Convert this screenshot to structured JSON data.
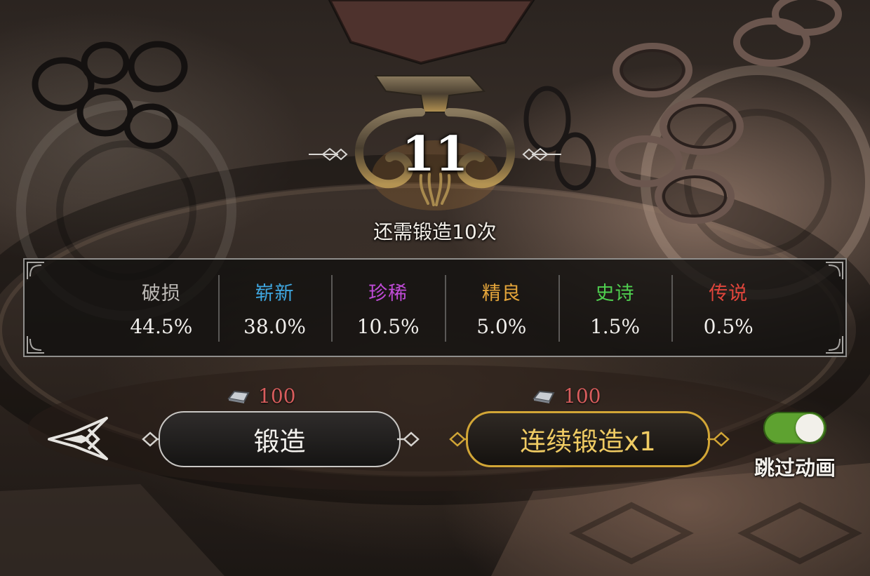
{
  "forge": {
    "count": "11",
    "remaining_text": "还需锻造10次"
  },
  "probabilities": [
    {
      "name": "破损",
      "value": "44.5%",
      "color": "#bdbab6"
    },
    {
      "name": "崭新",
      "value": "38.0%",
      "color": "#3fa7e0"
    },
    {
      "name": "珍稀",
      "value": "10.5%",
      "color": "#c04bd8"
    },
    {
      "name": "精良",
      "value": "5.0%",
      "color": "#e3a43a"
    },
    {
      "name": "史诗",
      "value": "1.5%",
      "color": "#4fce4f"
    },
    {
      "name": "传说",
      "value": "0.5%",
      "color": "#e0453b"
    }
  ],
  "costs": {
    "forge": "100",
    "continuous": "100"
  },
  "buttons": {
    "forge_label": "锻造",
    "continuous_label": "连续锻造x1"
  },
  "skip_animation": {
    "label": "跳过动画",
    "enabled": true
  },
  "colors": {
    "accent_gold": "#d2a636",
    "cost_red": "#d85d5d",
    "toggle_green": "#5ea230"
  },
  "icons": {
    "back": "back-arrow-icon",
    "material": "metal-ingot-icon",
    "emblem": "anvil-emblem-icon"
  }
}
